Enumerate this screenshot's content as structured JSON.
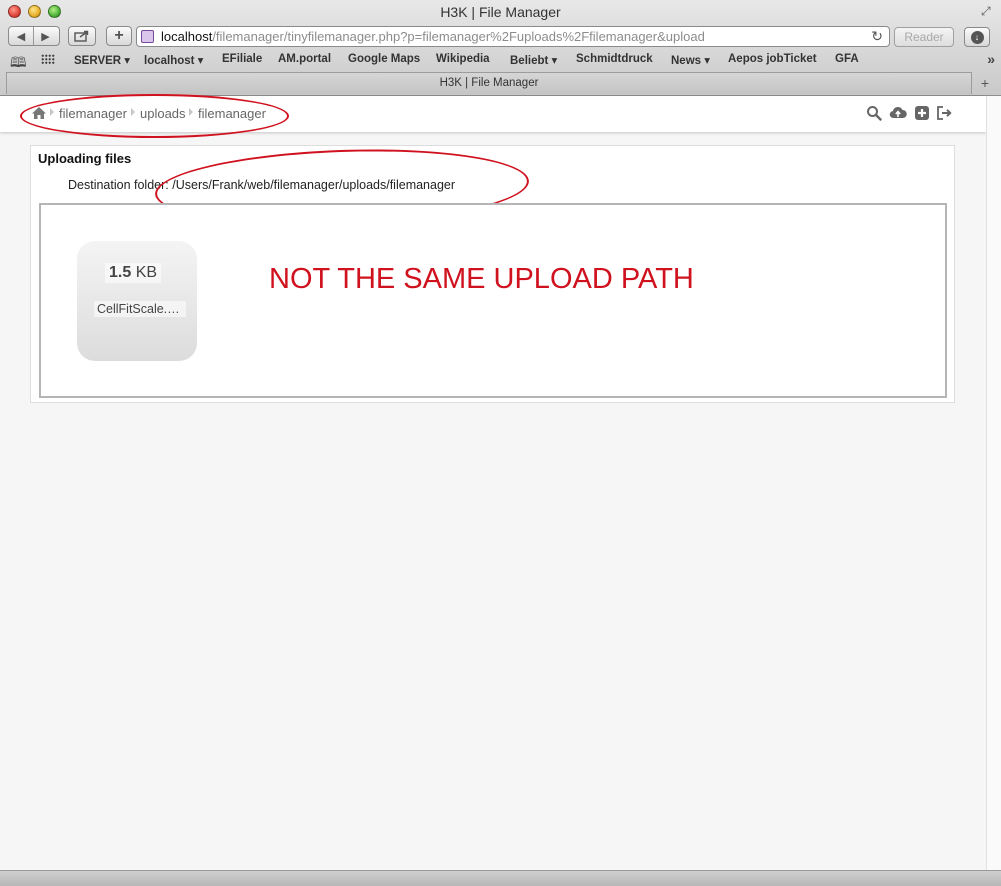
{
  "window": {
    "title": "H3K | File Manager"
  },
  "toolbar": {
    "url_host": "localhost",
    "url_path": "/filemanager/tinyfilemanager.php?p=filemanager%2Fuploads%2Ffilemanager&upload",
    "reader_label": "Reader"
  },
  "bookmarks": [
    {
      "label": "SERVER ▾"
    },
    {
      "label": "localhost ▾"
    },
    {
      "label": "EFiliale"
    },
    {
      "label": "AM.portal"
    },
    {
      "label": "Google Maps"
    },
    {
      "label": "Wikipedia"
    },
    {
      "label": "Beliebt ▾"
    },
    {
      "label": "Schmidtdruck"
    },
    {
      "label": "News ▾"
    },
    {
      "label": "Aepos jobTicket"
    },
    {
      "label": "GFA"
    }
  ],
  "tab": {
    "label": "H3K | File Manager"
  },
  "breadcrumb": [
    "filemanager",
    "uploads",
    "filemanager"
  ],
  "upload": {
    "title": "Uploading files",
    "destination_label": "Destination folder:",
    "destination_path": "/Users/Frank/web/filemanager/uploads/filemanager",
    "file": {
      "size_value": "1.5",
      "size_unit": "KB",
      "name": "CellFitScale.p..."
    }
  },
  "annotation": {
    "text": "NOT THE SAME UPLOAD PATH",
    "color": "#d0121f"
  }
}
